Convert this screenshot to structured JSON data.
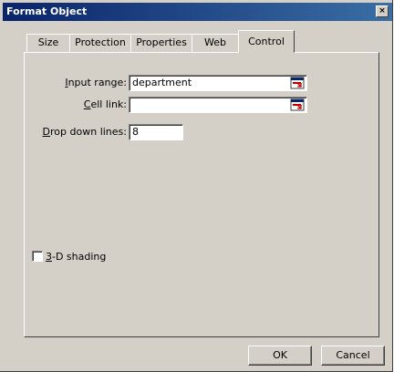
{
  "window": {
    "title": "Format Object",
    "close_glyph": "×"
  },
  "tabs": [
    {
      "label": "Size"
    },
    {
      "label": "Protection"
    },
    {
      "label": "Properties"
    },
    {
      "label": "Web"
    },
    {
      "label": "Control"
    }
  ],
  "active_tab": "Control",
  "form": {
    "input_range": {
      "label_pre": "",
      "label_accel": "I",
      "label_post": "nput range:",
      "value": "department"
    },
    "cell_link": {
      "label_pre": "",
      "label_accel": "C",
      "label_post": "ell link:",
      "value": ""
    },
    "drop_down_lines": {
      "label_pre": "",
      "label_accel": "D",
      "label_post": "rop down lines:",
      "value": "8"
    },
    "shading": {
      "label_pre": "",
      "label_accel": "3",
      "label_post": "-D shading",
      "checked": false
    }
  },
  "buttons": {
    "ok": "OK",
    "cancel": "Cancel"
  },
  "icons": {
    "refedit": "collapse-dialog-icon",
    "close": "close-icon"
  },
  "colors": {
    "title_start": "#0a246a",
    "title_end": "#3a6ea5",
    "face": "#d4d0c8"
  }
}
